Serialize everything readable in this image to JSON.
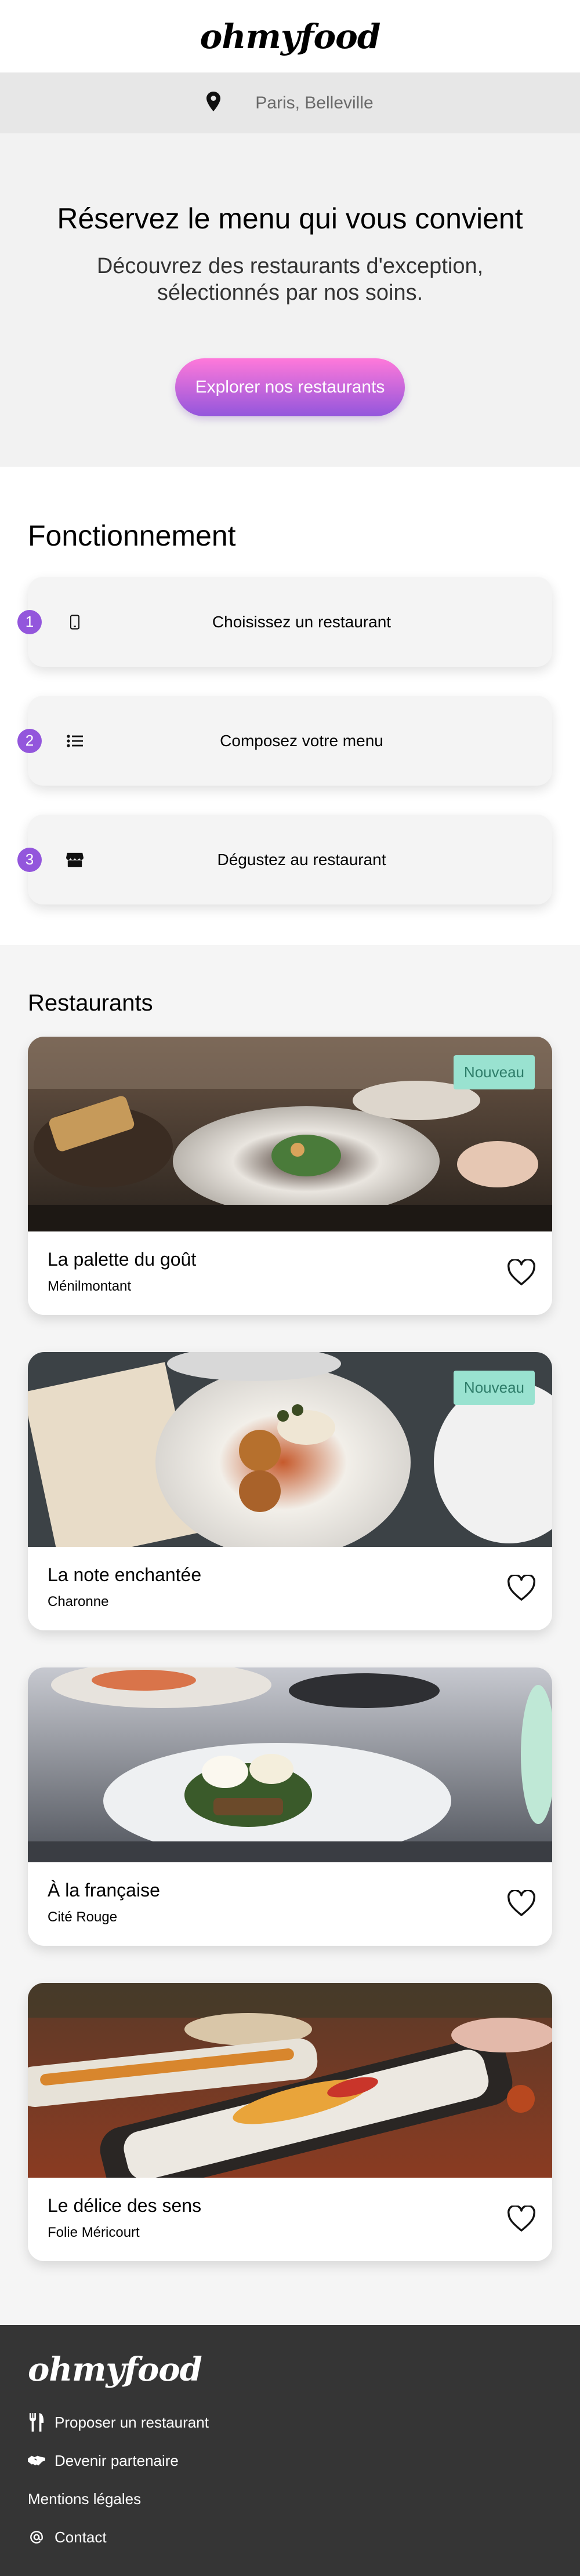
{
  "header": {
    "logo": "ohmyfood"
  },
  "location": {
    "icon": "map-pin-icon",
    "text": "Paris, Belleville"
  },
  "hero": {
    "title": "Réservez le menu qui vous convient",
    "subtitle": "Découvrez des restaurants d'exception, sélectionnés par nos soins.",
    "cta_label": "Explorer nos restaurants"
  },
  "how": {
    "title": "Fonctionnement",
    "steps": [
      {
        "number": "1",
        "icon": "mobile-phone-icon",
        "label": "Choisissez un restaurant"
      },
      {
        "number": "2",
        "icon": "list-icon",
        "label": "Composez votre menu"
      },
      {
        "number": "3",
        "icon": "store-icon",
        "label": "Dégustez au restaurant"
      }
    ]
  },
  "restaurants": {
    "title": "Restaurants",
    "items": [
      {
        "name": "La palette du goût",
        "area": "Ménilmontant",
        "badge": "Nouveau"
      },
      {
        "name": "La note enchantée",
        "area": "Charonne",
        "badge": "Nouveau"
      },
      {
        "name": "À la française",
        "area": "Cité Rouge"
      },
      {
        "name": "Le délice des sens",
        "area": "Folie Méricourt"
      }
    ]
  },
  "footer": {
    "logo": "ohmyfood",
    "links": [
      {
        "icon": "utensils-icon",
        "label": "Proposer un restaurant"
      },
      {
        "icon": "handshake-icon",
        "label": "Devenir partenaire"
      },
      {
        "label": "Mentions légales"
      },
      {
        "icon": "at-icon",
        "label": "Contact"
      }
    ]
  },
  "colors": {
    "accent_purple": "#9356dc",
    "accent_pink": "#ff79da",
    "badge_bg": "#99e2d0",
    "footer_bg": "#353535"
  }
}
